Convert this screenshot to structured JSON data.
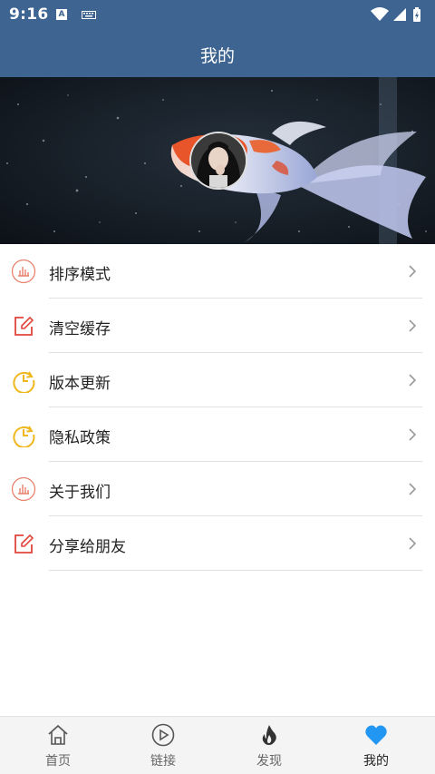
{
  "status_bar": {
    "time": "9:16",
    "input_icon_letter": "A"
  },
  "header": {
    "title": "我的"
  },
  "menu": {
    "items": [
      {
        "label": "排序模式",
        "icon": "bar-chart-icon",
        "color": "#e8806b"
      },
      {
        "label": "清空缓存",
        "icon": "edit-icon",
        "color": "#e0463a"
      },
      {
        "label": "版本更新",
        "icon": "clock-refresh-icon",
        "color": "#f0b71d"
      },
      {
        "label": "隐私政策",
        "icon": "clock-refresh-icon",
        "color": "#f0b71d"
      },
      {
        "label": "关于我们",
        "icon": "bar-chart-icon",
        "color": "#e8806b"
      },
      {
        "label": "分享给朋友",
        "icon": "edit-icon",
        "color": "#e0463a"
      }
    ]
  },
  "bottom_nav": {
    "items": [
      {
        "label": "首页",
        "icon": "home-icon"
      },
      {
        "label": "链接",
        "icon": "play-circle-icon"
      },
      {
        "label": "发现",
        "icon": "flame-icon"
      },
      {
        "label": "我的",
        "icon": "heart-icon",
        "active": true
      }
    ],
    "active_color": "#2196f3"
  },
  "colors": {
    "primary": "#3e6491"
  }
}
